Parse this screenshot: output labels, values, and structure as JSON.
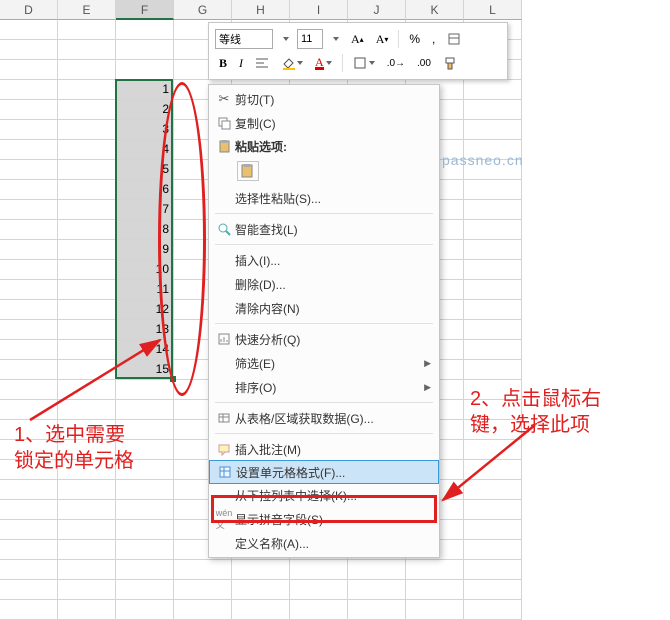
{
  "columns": [
    "D",
    "E",
    "F",
    "G",
    "H",
    "I",
    "J",
    "K",
    "L"
  ],
  "selected_col_index": 2,
  "selection_values": [
    "1",
    "2",
    "3",
    "4",
    "5",
    "6",
    "7",
    "8",
    "9",
    "10",
    "11",
    "12",
    "13",
    "14",
    "15"
  ],
  "selection_top_row": 3,
  "total_rows": 30,
  "mini_toolbar": {
    "font_name": "等线",
    "font_size": "11",
    "bold": "B",
    "italic": "I",
    "percent": "%"
  },
  "context_menu": {
    "cut": "剪切(T)",
    "copy": "复制(C)",
    "paste_options_heading": "粘贴选项:",
    "paste_special": "选择性粘贴(S)...",
    "smart_lookup": "智能查找(L)",
    "insert": "插入(I)...",
    "delete": "删除(D)...",
    "clear": "清除内容(N)",
    "quick_analysis": "快速分析(Q)",
    "filter": "筛选(E)",
    "sort": "排序(O)",
    "get_from_table": "从表格/区域获取数据(G)...",
    "insert_comment": "插入批注(M)",
    "format_cells": "设置单元格格式(F)...",
    "pick_from_list": "从下拉列表中选择(K)...",
    "show_pinyin": "显示拼音字段(S)",
    "define_name": "定义名称(A)..."
  },
  "annotations": {
    "a1": "1、选中需要\n锁定的单元格",
    "a2": "2、点击鼠标右\n键，选择此项"
  },
  "watermark": "passneo.cn"
}
